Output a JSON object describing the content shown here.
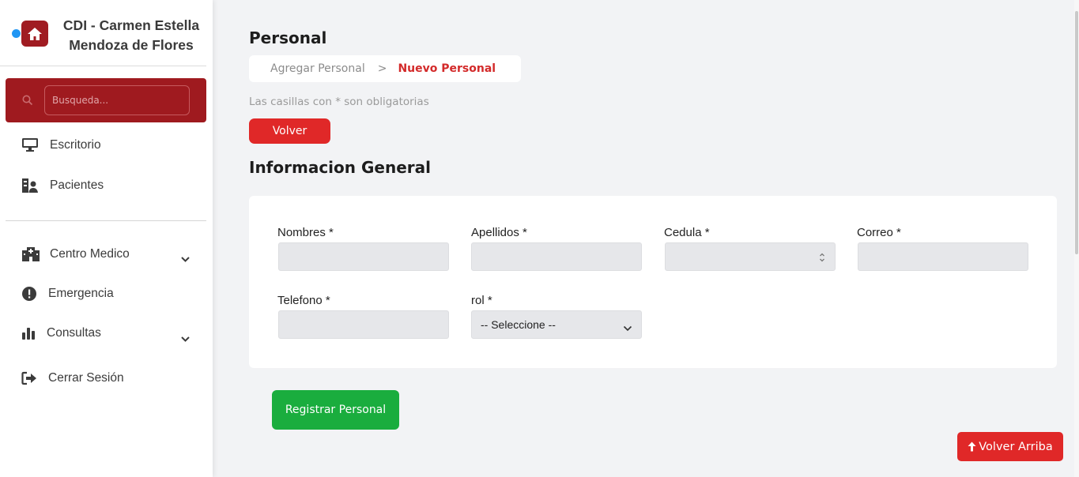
{
  "sidebar": {
    "brand_title": "CDI - Carmen Estella Mendoza de Flores",
    "search_placeholder": "Busqueda...",
    "items": [
      {
        "label": "Escritorio",
        "icon": "desktop-icon"
      },
      {
        "label": "Pacientes",
        "icon": "patients-icon"
      },
      {
        "label": "Centro Medico",
        "icon": "hospital-icon",
        "expandable": true
      },
      {
        "label": "Emergencia",
        "icon": "alert-circle-icon"
      },
      {
        "label": "Consultas",
        "icon": "bar-chart-icon",
        "expandable": true
      },
      {
        "label": "Cerrar Sesión",
        "icon": "logout-icon"
      }
    ]
  },
  "main": {
    "title": "Personal",
    "breadcrumb": {
      "link": "Agregar Personal",
      "separator": ">",
      "active": "Nuevo Personal"
    },
    "hint": "Las casillas con * son obligatorias",
    "back_button": "Volver",
    "section_title": "Informacion General",
    "fields": {
      "nombres": {
        "label": "Nombres *",
        "value": ""
      },
      "apellidos": {
        "label": "Apellidos *",
        "value": ""
      },
      "cedula": {
        "label": "Cedula *",
        "value": ""
      },
      "correo": {
        "label": "Correo *",
        "value": ""
      },
      "telefono": {
        "label": "Telefono *",
        "value": ""
      },
      "rol": {
        "label": "rol *",
        "selected": "-- Seleccione --"
      }
    },
    "submit_button": "Registrar Personal",
    "scroll_top_button": "Volver Arriba"
  },
  "colors": {
    "brand_red": "#a01c22",
    "accent_red": "#e02828",
    "success_green": "#1aad3e",
    "active_crumb": "#d32a2a"
  }
}
